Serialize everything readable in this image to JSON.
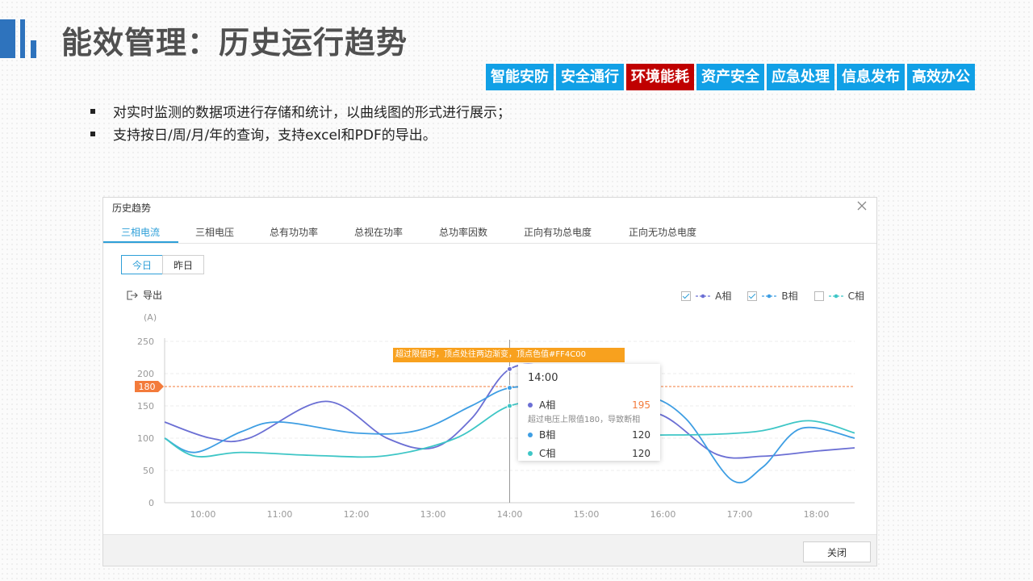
{
  "page": {
    "title": "能效管理：历史运行趋势",
    "nav_tabs": [
      {
        "label": "智能安防"
      },
      {
        "label": "安全通行"
      },
      {
        "label": "环境能耗"
      },
      {
        "label": "资产安全"
      },
      {
        "label": "应急处理"
      },
      {
        "label": "信息发布"
      },
      {
        "label": "高效办公"
      }
    ],
    "bullets": [
      "对实时监测的数据项进行存储和统计，以曲线图的形式进行展示；",
      "支持按日/周/月/年的查询，支持excel和PDF的导出。"
    ],
    "colors": {
      "brand_blue": "#11a0e6",
      "active_red": "#c00000",
      "accent_bar": "#2e73bd"
    }
  },
  "dialog": {
    "title": "历史趋势",
    "close_icon": "close-icon",
    "tabs": [
      "三相电流",
      "三相电压",
      "总有功功率",
      "总视在功率",
      "总功率因数",
      "正向有功总电度",
      "正向无功总电度"
    ],
    "active_tab": "三相电流",
    "segments": [
      "今日",
      "昨日"
    ],
    "active_segment": "今日",
    "export_label": "导出",
    "legend": [
      {
        "label": "A相",
        "checked": true,
        "color": "#6b6fd4"
      },
      {
        "label": "B相",
        "checked": true,
        "color": "#3e9ee3"
      },
      {
        "label": "C相",
        "checked": false,
        "color": "#3ec6c6"
      }
    ],
    "footer_close": "关闭"
  },
  "chart_data": {
    "type": "line",
    "ylabel": "(A)",
    "ylim": [
      0,
      250
    ],
    "yticks": [
      0,
      50,
      100,
      150,
      200,
      250
    ],
    "xlim": [
      9.5,
      18.5
    ],
    "xticks": [
      "10:00",
      "11:00",
      "12:00",
      "13:00",
      "14:00",
      "15:00",
      "16:00",
      "17:00",
      "18:00"
    ],
    "threshold": {
      "value": 180,
      "label": "180",
      "color": "#f37b3b"
    },
    "series": [
      {
        "name": "A相",
        "color": "#6b6fd4",
        "points": [
          [
            9.5,
            125
          ],
          [
            10.1,
            100
          ],
          [
            10.6,
            100
          ],
          [
            11.6,
            157
          ],
          [
            12.4,
            100
          ],
          [
            13.0,
            85
          ],
          [
            13.5,
            130
          ],
          [
            14.0,
            207
          ],
          [
            14.6,
            205
          ],
          [
            15.3,
            150
          ],
          [
            16.0,
            135
          ],
          [
            16.7,
            75
          ],
          [
            17.3,
            72
          ],
          [
            18.0,
            80
          ],
          [
            18.5,
            85
          ]
        ]
      },
      {
        "name": "B相",
        "color": "#3e9ee3",
        "points": [
          [
            9.5,
            100
          ],
          [
            9.9,
            78
          ],
          [
            10.5,
            110
          ],
          [
            11.0,
            125
          ],
          [
            12.0,
            108
          ],
          [
            12.8,
            112
          ],
          [
            13.5,
            150
          ],
          [
            14.0,
            178
          ],
          [
            14.6,
            175
          ],
          [
            15.2,
            160
          ],
          [
            15.8,
            165
          ],
          [
            16.3,
            130
          ],
          [
            16.9,
            35
          ],
          [
            17.3,
            55
          ],
          [
            17.8,
            115
          ],
          [
            18.5,
            100
          ]
        ]
      },
      {
        "name": "C相",
        "color": "#3ec6c6",
        "points": [
          [
            9.5,
            100
          ],
          [
            9.9,
            72
          ],
          [
            10.5,
            78
          ],
          [
            11.5,
            73
          ],
          [
            12.4,
            73
          ],
          [
            13.3,
            100
          ],
          [
            14.0,
            150
          ],
          [
            14.6,
            150
          ],
          [
            15.2,
            110
          ],
          [
            16.1,
            105
          ],
          [
            17.2,
            110
          ],
          [
            17.9,
            127
          ],
          [
            18.5,
            108
          ]
        ]
      }
    ],
    "annotation": "超过限值时，顶点处往两边渐变，顶点色值#FF4C00",
    "tooltip": {
      "time": "14:00",
      "rows": [
        {
          "name": "A相",
          "value": "195",
          "color": "#6b6fd4",
          "value_color": "#f37b3b"
        },
        {
          "name": "B相",
          "value": "120",
          "color": "#3e9ee3",
          "value_color": "#333333"
        },
        {
          "name": "C相",
          "value": "120",
          "color": "#3ec6c6",
          "value_color": "#333333"
        }
      ],
      "note": "超过电压上限值180，导致断相"
    },
    "hover_x": 14.0,
    "hover_points": {
      "A相": 207,
      "B相": 178,
      "C相": 150
    }
  }
}
